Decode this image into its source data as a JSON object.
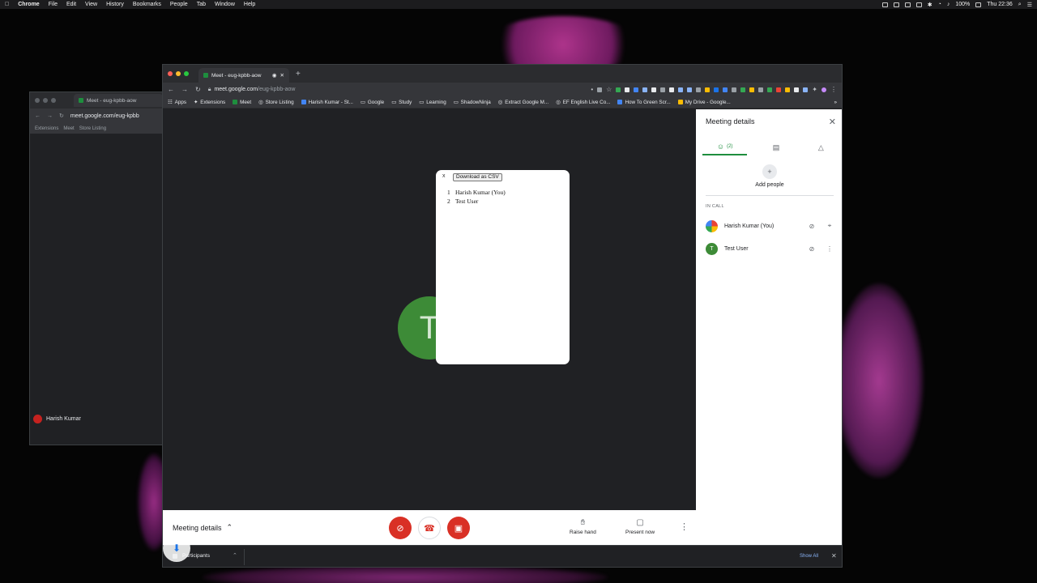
{
  "menubar": {
    "app": "Chrome",
    "items": [
      "File",
      "Edit",
      "View",
      "History",
      "Bookmarks",
      "People",
      "Tab",
      "Window",
      "Help"
    ],
    "battery": "100%",
    "clock": "Thu 22:36"
  },
  "bg_window": {
    "tab_title": "Meet - eug-kpbb-aow",
    "url": "meet.google.com/eug-kpbb",
    "bookmarks": [
      "Extensions",
      "Meet",
      "Store Listing"
    ],
    "user_name": "Harish Kumar"
  },
  "main_window": {
    "tab_title": "Meet - eug-kpbb-aow",
    "url_host": "meet.google.com",
    "url_path": "/eug-kpbb-aow",
    "bookmarks": [
      "Apps",
      "Extensions",
      "Meet",
      "Store Listing",
      "Harish Kumar - St...",
      "Google",
      "Study",
      "Learning",
      "ShadowNinja",
      "Extract Google M...",
      "EF English Live Co...",
      "How To Green Scr...",
      "My Drive - Google..."
    ]
  },
  "tile": {
    "initial": "T"
  },
  "popup": {
    "close_label": "x",
    "download_label": "Download as CSV",
    "participants": [
      {
        "num": "1",
        "name": "Harish Kumar (You)"
      },
      {
        "num": "2",
        "name": "Test User"
      }
    ]
  },
  "panel": {
    "title": "Meeting details",
    "people_count": "(2)",
    "add_people": "Add people",
    "in_call_label": "IN CALL",
    "participants": [
      {
        "name": "Harish Kumar (You)",
        "initial": "",
        "color": "#4285f4"
      },
      {
        "name": "Test User",
        "initial": "T",
        "color": "#3d8b37"
      }
    ]
  },
  "controls": {
    "meeting_details": "Meeting details",
    "raise_hand": "Raise hand",
    "present_now": "Present now",
    "colors": {
      "red": "#d93025"
    }
  },
  "download_bar": {
    "item": "Participants",
    "show_all": "Show All"
  }
}
